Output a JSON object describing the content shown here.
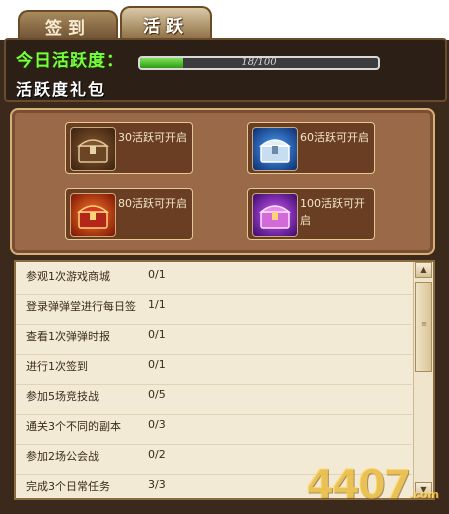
{
  "tabs": [
    {
      "label": "签到",
      "active": false
    },
    {
      "label": "活跃",
      "active": true
    }
  ],
  "activity": {
    "label": "今日活跃度：",
    "current": 18,
    "max": 100,
    "progress_text": "18/100",
    "fill_color": "#2f9a14"
  },
  "gift_title": "活跃度礼包",
  "gifts": [
    {
      "label": "30活跃可开启",
      "chest": "bronze-chest-icon",
      "color": "#8a5a30"
    },
    {
      "label": "60活跃可开启",
      "chest": "blue-chest-icon",
      "color": "#3d7fd6"
    },
    {
      "label": "80活跃可开启",
      "chest": "red-chest-icon",
      "color": "#d43a18"
    },
    {
      "label": "100活跃可开启",
      "chest": "purple-chest-icon",
      "color": "#b03ad6"
    }
  ],
  "tasks": [
    {
      "name": "参观1次游戏商城",
      "progress": "0/1"
    },
    {
      "name": "登录弹弹堂进行每日签",
      "progress": "1/1"
    },
    {
      "name": "查看1次弹弹时报",
      "progress": "0/1"
    },
    {
      "name": "进行1次签到",
      "progress": "0/1"
    },
    {
      "name": "参加5场竞技战",
      "progress": "0/5"
    },
    {
      "name": "通关3个不同的副本",
      "progress": "0/3"
    },
    {
      "name": "参加2场公会战",
      "progress": "0/2"
    },
    {
      "name": "完成3个日常任务",
      "progress": "3/3"
    }
  ],
  "watermark": {
    "text": "4407",
    "suffix": ".com"
  }
}
